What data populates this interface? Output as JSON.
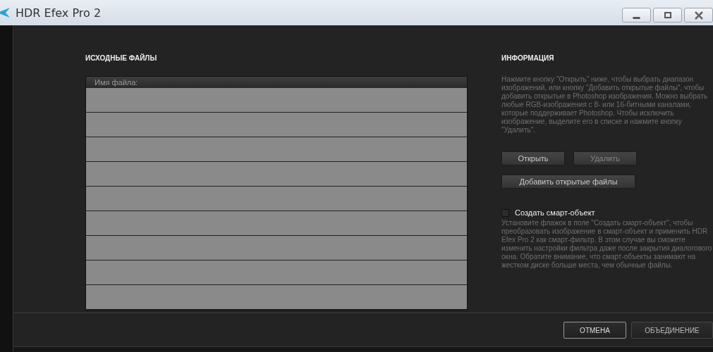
{
  "window": {
    "title": "HDR Efex Pro 2"
  },
  "source_files": {
    "heading": "ИСХОДНЫЕ ФАЙЛЫ",
    "column": "Имя файла:"
  },
  "info": {
    "heading": "ИНФОРМАЦИЯ",
    "text": "Нажмите кнопку \"Открыть\" ниже, чтобы выбрать диапазон изображений, или кнопку \"Добавить открытые файлы\", чтобы добавить открытые в Photoshop изображения. Можно выбрать любые RGB-изображения с 8- или 16-битными каналами, которые поддерживает Photoshop. Чтобы исключить изображение, выделите его в списке и нажмите кнопку \"Удалить\"."
  },
  "file_buttons": [
    {
      "label": "Открыть",
      "disabled": false
    },
    {
      "label": "Удалить",
      "disabled": true
    }
  ],
  "add_button": {
    "label": "Добавить открытые файлы",
    "disabled": false
  },
  "smart_object": {
    "label": "Создать смарт-объект",
    "checked": false,
    "description": "Установите флажок в поле \"Создать смарт-объект\", чтобы преобразовать изображение в смарт-объект и применить HDR Efex Pro 2 как смарт-фильтр. В этом случае вы сможете изменить настройки фильтра даже после закрытия диалогового окна. Обратите внимание, что смарт-объекты занимают на жестком диске больше места, чем обычные файлы."
  },
  "footer_buttons": [
    {
      "label": "ОТМЕНА",
      "selected": true
    },
    {
      "label": "ОБЪЕДИНЕНИЕ",
      "selected": false
    }
  ]
}
